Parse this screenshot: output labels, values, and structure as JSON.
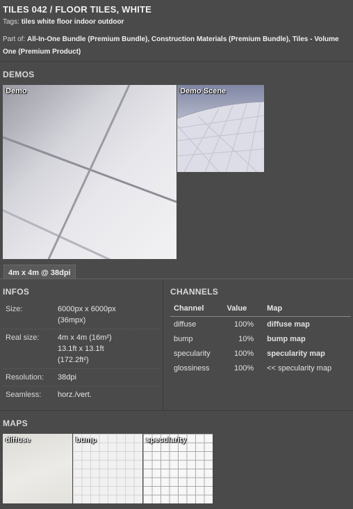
{
  "header": {
    "title": "TILES 042 / FLOOR TILES, WHITE",
    "tags_prefix": "Tags:",
    "tags": "tiles white floor indoor outdoor",
    "partof_prefix": "Part of:",
    "partof": "All-In-One Bundle (Premium Bundle), Construction Materials (Premium Bundle), Tiles - Volume One (Premium Product)"
  },
  "demos": {
    "title": "DEMOS",
    "items": [
      "Demo",
      "Demo Scene"
    ],
    "size_tab": "4m x 4m @ 38dpi"
  },
  "infos": {
    "title": "INFOS",
    "rows": [
      {
        "key": "Size:",
        "value": [
          "6000px x 6000px",
          "(36mpx)"
        ]
      },
      {
        "key": "Real size:",
        "value": [
          "4m x 4m (16m²)",
          "13.1ft x 13.1ft",
          "(172.2ft²)"
        ]
      },
      {
        "key": "Resolution:",
        "value": [
          "38dpi"
        ]
      },
      {
        "key": "Seamless:",
        "value": [
          "horz./vert."
        ]
      }
    ]
  },
  "channels": {
    "title": "CHANNELS",
    "headers": [
      "Channel",
      "Value",
      "Map"
    ],
    "rows": [
      {
        "channel": "diffuse",
        "value": "100%",
        "map": "diffuse map"
      },
      {
        "channel": "bump",
        "value": "10%",
        "map": "bump map"
      },
      {
        "channel": "specularity",
        "value": "100%",
        "map": "specularity map"
      },
      {
        "channel": "glossiness",
        "value": "100%",
        "map": "<< specularity map"
      }
    ]
  },
  "maps": {
    "title": "MAPS",
    "items": [
      "diffuse",
      "bump",
      "specularity"
    ]
  }
}
